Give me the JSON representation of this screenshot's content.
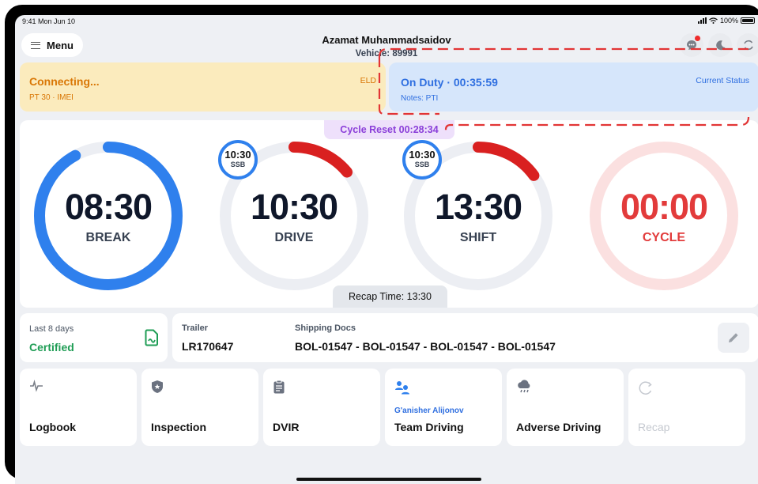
{
  "status_bar": {
    "time": "9:41  Mon Jun 10",
    "battery": "100%"
  },
  "header": {
    "menu_label": "Menu",
    "driver_name": "Azamat Muhammadsaidov",
    "vehicle": "Vehicle: 89991",
    "icons": [
      "chat-icon",
      "moon-icon",
      "sync-icon"
    ]
  },
  "eld_card": {
    "title": "Connecting...",
    "subtitle": "PT 30 · IMEI",
    "tag": "ELD"
  },
  "duty_card": {
    "title": "On Duty · 00:35:59",
    "notes": "Notes: PTI",
    "tag": "Current Status"
  },
  "cycle_reset": "Cycle Reset 00:28:34",
  "recap_time": "Recap Time: 13:30",
  "gauges": [
    {
      "value": "08:30",
      "label": "BREAK",
      "progress": 0.92,
      "color": "#2f80ed"
    },
    {
      "value": "10:30",
      "label": "DRIVE",
      "progress": 0.14,
      "color": "#d92020",
      "badge": {
        "value": "10:30",
        "label": "SSB"
      }
    },
    {
      "value": "13:30",
      "label": "SHIFT",
      "progress": 0.15,
      "color": "#d92020",
      "badge": {
        "value": "10:30",
        "label": "SSB"
      }
    },
    {
      "value": "00:00",
      "label": "CYCLE",
      "progress": 0.0,
      "color": "#e23b3b"
    }
  ],
  "certification": {
    "period": "Last 8 days",
    "status": "Certified"
  },
  "trailer": {
    "label": "Trailer",
    "value": "LR170647"
  },
  "shipping_docs": {
    "label": "Shipping Docs",
    "value": "BOL-01547 - BOL-01547 - BOL-01547 - BOL-01547"
  },
  "tiles": [
    {
      "label": "Logbook",
      "icon": "pulse-icon"
    },
    {
      "label": "Inspection",
      "icon": "shield-icon"
    },
    {
      "label": "DVIR",
      "icon": "clipboard-icon"
    },
    {
      "label": "Team Driving",
      "sub": "G'anisher Alijonov",
      "icon": "team-icon"
    },
    {
      "label": "Adverse Driving",
      "icon": "weather-icon"
    },
    {
      "label": "Recap",
      "icon": "recap-icon",
      "disabled": true
    }
  ],
  "colors": {
    "blue": "#2f80ed",
    "red": "#d92020",
    "green": "#1f9d55",
    "amber": "#d97706",
    "purple": "#8b3fd9"
  }
}
